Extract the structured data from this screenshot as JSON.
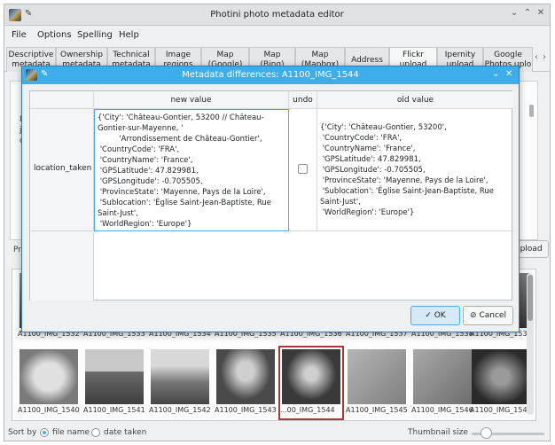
{
  "window": {
    "title": "Photini photo metadata editor"
  },
  "menu": [
    "File",
    "Options",
    "Spelling",
    "Help"
  ],
  "tabs": [
    {
      "line1": "Descriptive",
      "line2": "metadata"
    },
    {
      "line1": "Ownership",
      "line2": "metadata"
    },
    {
      "line1": "Technical",
      "line2": "metadata"
    },
    {
      "line1": "Image",
      "line2": "regions"
    },
    {
      "line1": "Map",
      "line2": "(Google)"
    },
    {
      "line1": "Map",
      "line2": "(Bing)"
    },
    {
      "line1": "Map",
      "line2": "(Mapbox)"
    },
    {
      "line1": "Address",
      "line2": ""
    },
    {
      "line1": "Flickr",
      "line2": "upload"
    },
    {
      "line1": "Ipernity",
      "line2": "upload"
    },
    {
      "line1": "Google",
      "line2": "Photos uplo"
    }
  ],
  "background": {
    "left_text_1": "Lo",
    "left_text_2": "ji",
    "left_text_3": "o",
    "bottom_left": "Pro",
    "upload_button": "Upload"
  },
  "thumbnails": {
    "row1": [
      "A1100_IMG_1532",
      "A1100_IMG_1533",
      "A1100_IMG_1534",
      "A1100_IMG_1535",
      "A1100_IMG_1536",
      "A1100_IMG_1537",
      "A1100_IMG_1538",
      "A1100_IMG_1539"
    ],
    "row2": [
      "A1100_IMG_1540",
      "A1100_IMG_1541",
      "A1100_IMG_1542",
      "A1100_IMG_1543",
      "...00_IMG_1544",
      "A1100_IMG_1545",
      "A1100_IMG_1546",
      "A1100_IMG_1547"
    ]
  },
  "status": {
    "sort_by": "Sort by",
    "file_name": "file name",
    "date_taken": "date taken",
    "thumbnail_size": "Thumbnail size"
  },
  "dialog": {
    "title": "Metadata differences: A1100_IMG_1544",
    "col_new": "new value",
    "col_undo": "undo",
    "col_old": "old value",
    "row_label": "location_taken",
    "new_value": "{'City': 'Château-Gontier, 53200 // Château-Gontier-sur-Mayenne, '\n         'Arrondissement de Château-Gontier',\n 'CountryCode': 'FRA',\n 'CountryName': 'France',\n 'GPSLatitude': 47.829981,\n 'GPSLongitude': -0.705505,\n 'ProvinceState': 'Mayenne, Pays de la Loire',\n 'Sublocation': 'Église Saint-Jean-Baptiste, Rue Saint-Just',\n 'WorldRegion': 'Europe'}",
    "old_value": "{'City': 'Château-Gontier, 53200',\n 'CountryCode': 'FRA',\n 'CountryName': 'France',\n 'GPSLatitude': 47.829981,\n 'GPSLongitude': -0.705505,\n 'ProvinceState': 'Mayenne, Pays de la Loire',\n 'Sublocation': 'Église Saint-Jean-Baptiste, Rue Saint-Just',\n 'WorldRegion': 'Europe'}",
    "ok": "OK",
    "cancel": "Cancel"
  }
}
